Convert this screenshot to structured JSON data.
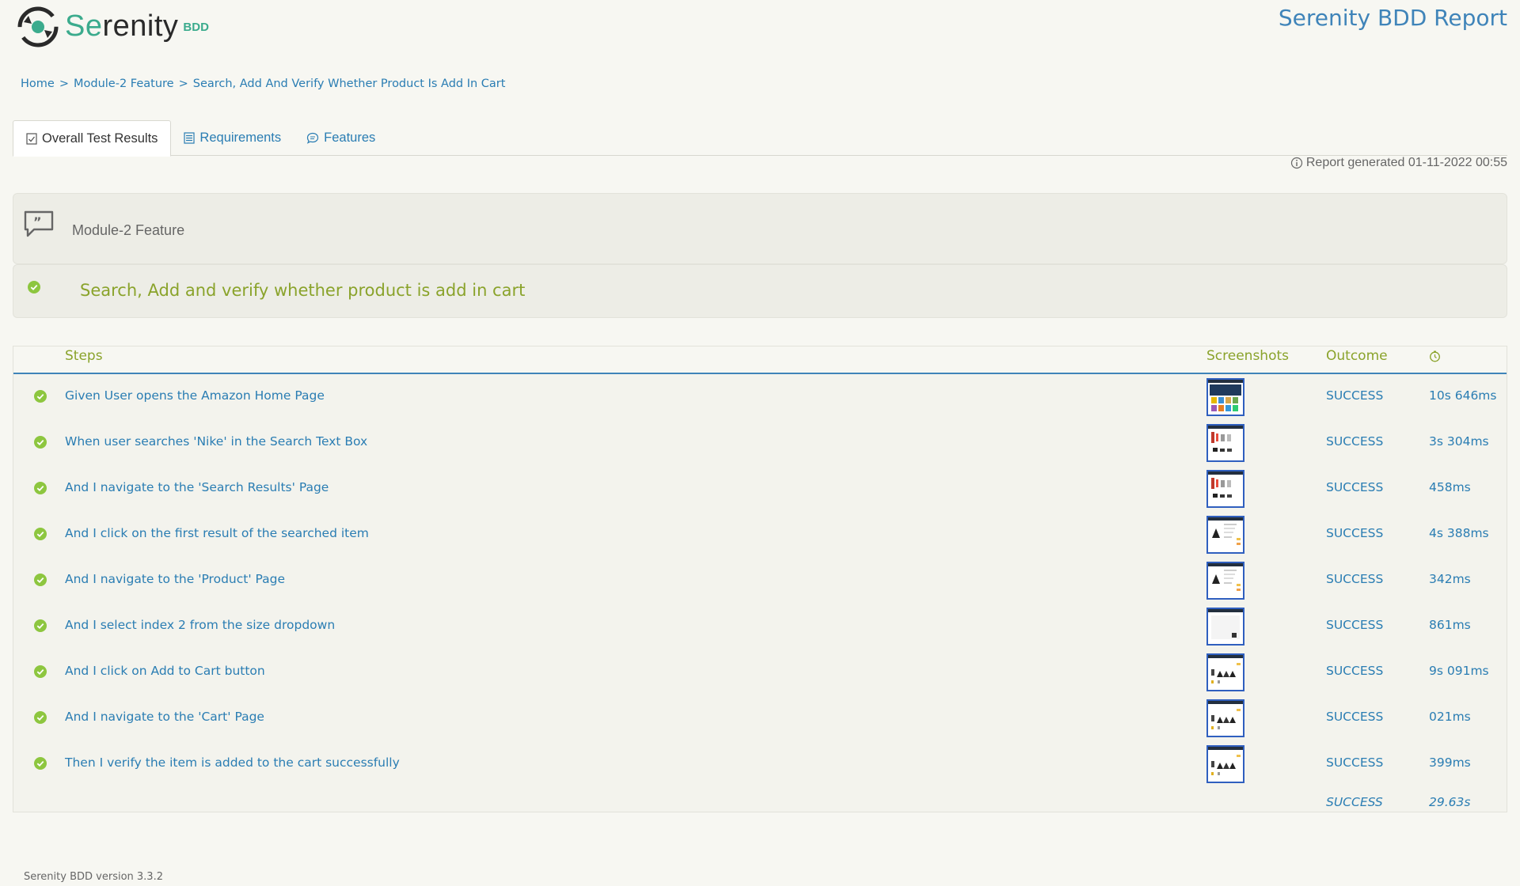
{
  "header": {
    "logo_text_a": "Se",
    "logo_text_b": "renity",
    "logo_sub": "BDD",
    "report_title": "Serenity BDD Report"
  },
  "breadcrumb": [
    "Home",
    "Module-2 Feature",
    "Search, Add And Verify Whether Product Is Add In Cart"
  ],
  "breadcrumb_sep": ">",
  "tabs": [
    {
      "label": "Overall Test Results",
      "icon": "checklist-icon"
    },
    {
      "label": "Requirements",
      "icon": "list-icon"
    },
    {
      "label": "Features",
      "icon": "speech-bubble-icon"
    }
  ],
  "report_generated": "Report generated 01-11-2022 00:55",
  "feature": {
    "name": "Module-2 Feature",
    "icon": "quote-bubble-icon"
  },
  "scenario": {
    "title": "Search, Add and verify whether product is add in cart",
    "status": "success"
  },
  "steps_table": {
    "headers": {
      "steps": "Steps",
      "screenshots": "Screenshots",
      "outcome": "Outcome",
      "duration_icon": "clock-icon"
    },
    "rows": [
      {
        "desc": "Given User opens the Amazon Home Page",
        "outcome": "SUCCESS",
        "duration": "10s 646ms",
        "thumb": "home"
      },
      {
        "desc": "When user searches 'Nike' in the Search Text Box",
        "outcome": "SUCCESS",
        "duration": "3s 304ms",
        "thumb": "search"
      },
      {
        "desc": "And I navigate to the 'Search Results' Page",
        "outcome": "SUCCESS",
        "duration": "458ms",
        "thumb": "search"
      },
      {
        "desc": "And I click on the first result of the searched item",
        "outcome": "SUCCESS",
        "duration": "4s 388ms",
        "thumb": "product"
      },
      {
        "desc": "And I navigate to the 'Product' Page",
        "outcome": "SUCCESS",
        "duration": "342ms",
        "thumb": "product"
      },
      {
        "desc": "And I select index 2 from the size dropdown",
        "outcome": "SUCCESS",
        "duration": "861ms",
        "thumb": "blank"
      },
      {
        "desc": "And I click on Add to Cart button",
        "outcome": "SUCCESS",
        "duration": "9s 091ms",
        "thumb": "cart"
      },
      {
        "desc": "And I navigate to the 'Cart' Page",
        "outcome": "SUCCESS",
        "duration": "021ms",
        "thumb": "cart"
      },
      {
        "desc": "Then I verify the item is added to the cart successfully",
        "outcome": "SUCCESS",
        "duration": "399ms",
        "thumb": "cart"
      }
    ],
    "total": {
      "outcome": "SUCCESS",
      "duration": "29.63s"
    }
  },
  "footer": "Serenity BDD version 3.3.2",
  "colors": {
    "accent_blue": "#2a7db3",
    "success_green": "#8aa32b",
    "check_green": "#8dc63f",
    "brand_teal": "#3bab8d"
  }
}
